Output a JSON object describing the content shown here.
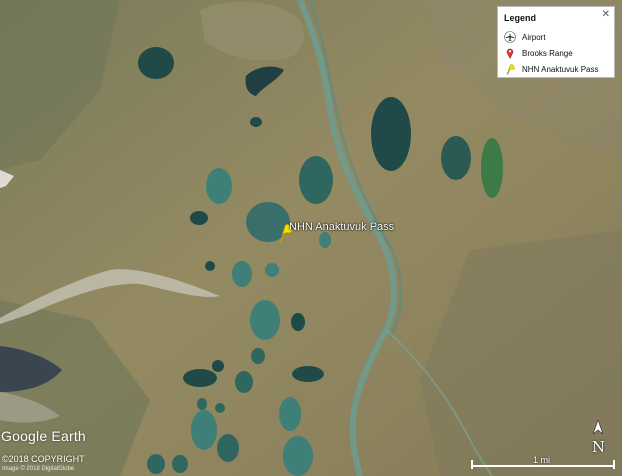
{
  "legend": {
    "title": "Legend",
    "close_glyph": "✕",
    "items": [
      {
        "label": "Airport",
        "icon": "airplane-icon"
      },
      {
        "label": "Brooks Range",
        "icon": "map-pin-icon",
        "color": "#d23c32"
      },
      {
        "label": "NHN Anaktuvuk Pass",
        "icon": "yellow-pushpin-icon",
        "color": "#f2e200"
      }
    ]
  },
  "placemark": {
    "label": "NHN Anaktuvuk Pass",
    "color": "#f2e200"
  },
  "brand": "Google Earth",
  "copyright": "©2018 COPYRIGHT",
  "imagery_credit": "Image © 2018 DigitalGlobe",
  "scale": {
    "label": "1 mi"
  },
  "compass": {
    "label": "N"
  },
  "colors": {
    "terrain": "#8a8461",
    "lake_dark": "#1f4a48",
    "lake_teal": "#3e7f78",
    "lake_green": "#3c7a48",
    "river": "#6c9e93"
  }
}
